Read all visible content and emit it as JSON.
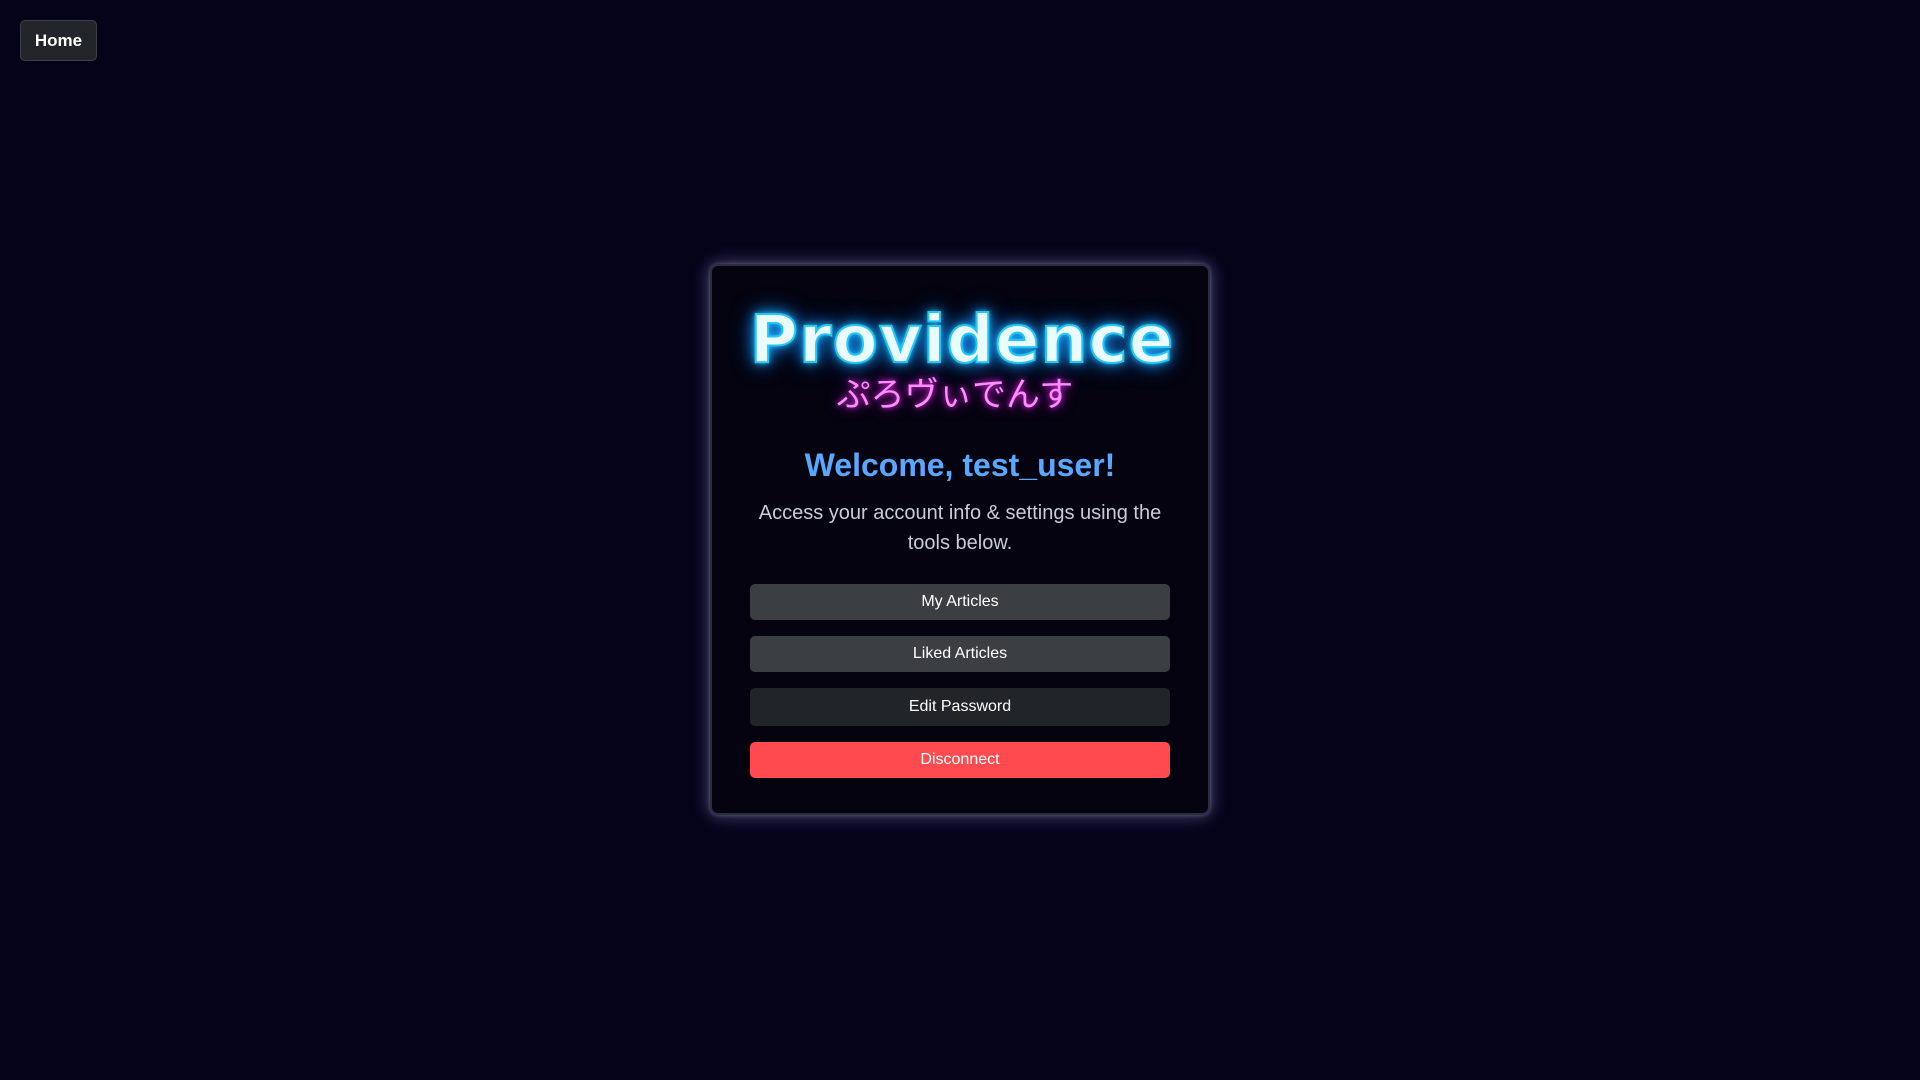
{
  "nav": {
    "home_label": "Home"
  },
  "logo": {
    "title": "Providence",
    "subtitle": "ぷろヴぃでんす"
  },
  "card": {
    "welcome": "Welcome, test_user!",
    "description": "Access your account info & settings using the tools below.",
    "buttons": [
      {
        "label": "My Articles"
      },
      {
        "label": "Liked Articles"
      },
      {
        "label": "Edit Password"
      },
      {
        "label": "Disconnect"
      }
    ]
  },
  "colors": {
    "background": "#05031a",
    "accent": "#5aa7ff",
    "danger": "#ff4a4f",
    "logo_cyan": "#22c8f5",
    "logo_magenta": "#ff8cff"
  }
}
